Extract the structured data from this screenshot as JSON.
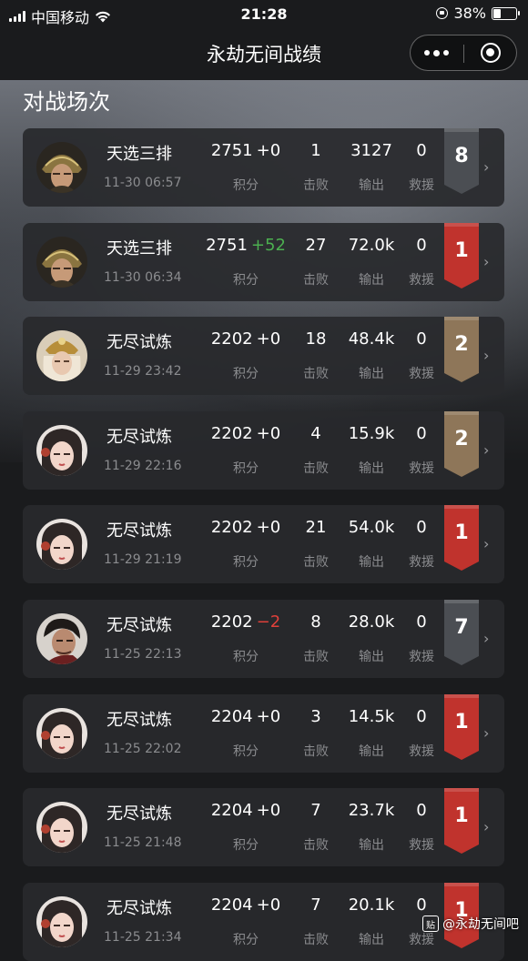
{
  "status_bar": {
    "carrier": "中国移动",
    "time": "21:28",
    "battery": "38%",
    "battery_level": 0.38
  },
  "nav": {
    "title": "永劫无间战绩",
    "more_icon": "more-dots-icon",
    "close_icon": "close-target-icon"
  },
  "section_title": "对战场次",
  "labels": {
    "score": "积分",
    "kills": "击败",
    "damage": "输出",
    "rescue": "救援"
  },
  "colors": {
    "gain": "#4cb050",
    "loss": "#e0403a",
    "badge_gray": "#4b4e53",
    "badge_red": "#c0332d",
    "badge_bronze": "#8e7659"
  },
  "matches": [
    {
      "mode": "天选三排",
      "date": "11-30 06:57",
      "score": "2751",
      "delta": "+0",
      "delta_type": "neutral",
      "kills": "1",
      "damage": "3127",
      "rescue": "0",
      "rank": "8",
      "rank_style": "gray",
      "avatar": "helmet"
    },
    {
      "mode": "天选三排",
      "date": "11-30 06:34",
      "score": "2751",
      "delta": "+52",
      "delta_type": "gain",
      "kills": "27",
      "damage": "72.0k",
      "rescue": "0",
      "rank": "1",
      "rank_style": "red",
      "avatar": "helmet"
    },
    {
      "mode": "无尽试炼",
      "date": "11-29 23:42",
      "score": "2202",
      "delta": "+0",
      "delta_type": "neutral",
      "kills": "18",
      "damage": "48.4k",
      "rescue": "0",
      "rank": "2",
      "rank_style": "bronze",
      "avatar": "crown"
    },
    {
      "mode": "无尽试炼",
      "date": "11-29 22:16",
      "score": "2202",
      "delta": "+0",
      "delta_type": "neutral",
      "kills": "4",
      "damage": "15.9k",
      "rescue": "0",
      "rank": "2",
      "rank_style": "bronze",
      "avatar": "female"
    },
    {
      "mode": "无尽试炼",
      "date": "11-29 21:19",
      "score": "2202",
      "delta": "+0",
      "delta_type": "neutral",
      "kills": "21",
      "damage": "54.0k",
      "rescue": "0",
      "rank": "1",
      "rank_style": "red",
      "avatar": "female"
    },
    {
      "mode": "无尽试炼",
      "date": "11-25 22:13",
      "score": "2202",
      "delta": "−2",
      "delta_type": "loss",
      "kills": "8",
      "damage": "28.0k",
      "rescue": "0",
      "rank": "7",
      "rank_style": "gray",
      "avatar": "male"
    },
    {
      "mode": "无尽试炼",
      "date": "11-25 22:02",
      "score": "2204",
      "delta": "+0",
      "delta_type": "neutral",
      "kills": "3",
      "damage": "14.5k",
      "rescue": "0",
      "rank": "1",
      "rank_style": "red",
      "avatar": "female"
    },
    {
      "mode": "无尽试炼",
      "date": "11-25 21:48",
      "score": "2204",
      "delta": "+0",
      "delta_type": "neutral",
      "kills": "7",
      "damage": "23.7k",
      "rescue": "0",
      "rank": "1",
      "rank_style": "red",
      "avatar": "female"
    },
    {
      "mode": "无尽试炼",
      "date": "11-25 21:34",
      "score": "2204",
      "delta": "+0",
      "delta_type": "neutral",
      "kills": "7",
      "damage": "20.1k",
      "rescue": "0",
      "rank": "1",
      "rank_style": "red",
      "avatar": "female"
    }
  ],
  "watermark": {
    "icon": "tieba-icon",
    "icon_text": "贴",
    "text": "@永劫无间吧"
  }
}
